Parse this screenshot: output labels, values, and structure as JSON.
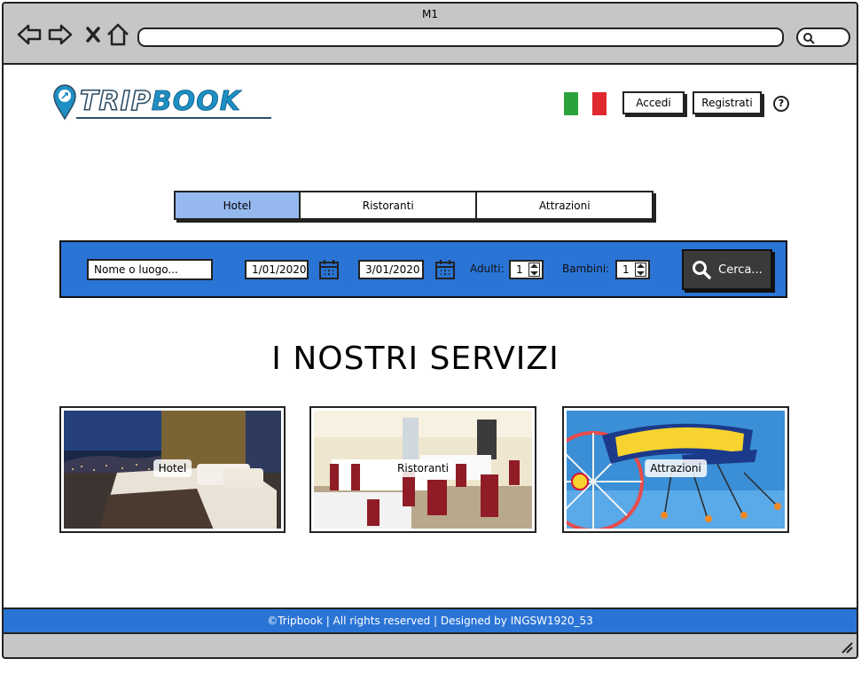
{
  "window": {
    "title": "M1"
  },
  "header": {
    "brand_part1": "TRIP",
    "brand_part2": "BOOK",
    "login_label": "Accedi",
    "register_label": "Registrati",
    "help_label": "?",
    "flag_colors": [
      "#2aa33b",
      "#ffffff",
      "#e0292f"
    ]
  },
  "tabs": [
    {
      "label": "Hotel",
      "active": true
    },
    {
      "label": "Ristoranti",
      "active": false
    },
    {
      "label": "Attrazioni",
      "active": false
    }
  ],
  "search": {
    "place_placeholder": "Nome o luogo...",
    "checkin": "1/01/2020",
    "checkout": "3/01/2020",
    "adults_label": "Adulti:",
    "adults_value": "1",
    "children_label": "Bambini:",
    "children_value": "1",
    "search_button": "Cerca..."
  },
  "services": {
    "title": "I NOSTRI SERVIZI",
    "cards": [
      {
        "label": "Hotel"
      },
      {
        "label": "Ristoranti"
      },
      {
        "label": "Attrazioni"
      }
    ]
  },
  "footer": {
    "text": "©Tripbook | All rights reserved | Designed by INGSW1920_53"
  },
  "colors": {
    "primary": "#2a74d6",
    "active_tab": "#95b8ef",
    "button_dark": "#3a3a3a"
  }
}
